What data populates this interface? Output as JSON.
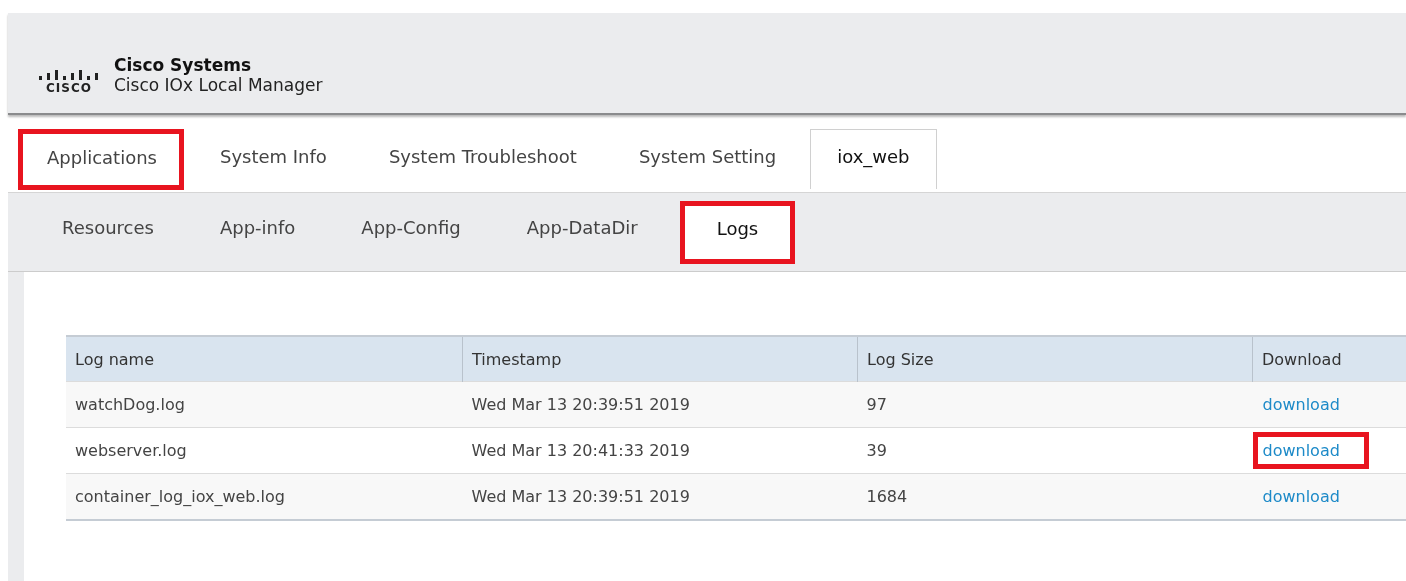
{
  "header": {
    "logo_text": "CISCO",
    "company": "Cisco Systems",
    "product": "Cisco IOx Local Manager"
  },
  "tabs": [
    {
      "label": "Applications",
      "selected": false,
      "highlighted": true
    },
    {
      "label": "System Info",
      "selected": false,
      "highlighted": false
    },
    {
      "label": "System Troubleshoot",
      "selected": false,
      "highlighted": false
    },
    {
      "label": "System Setting",
      "selected": false,
      "highlighted": false
    },
    {
      "label": "iox_web",
      "selected": true,
      "highlighted": false
    }
  ],
  "subtabs": [
    {
      "label": "Resources",
      "selected": false,
      "highlighted": false
    },
    {
      "label": "App-info",
      "selected": false,
      "highlighted": false
    },
    {
      "label": "App-Config",
      "selected": false,
      "highlighted": false
    },
    {
      "label": "App-DataDir",
      "selected": false,
      "highlighted": false
    },
    {
      "label": "Logs",
      "selected": true,
      "highlighted": true
    }
  ],
  "table": {
    "columns": [
      "Log name",
      "Timestamp",
      "Log Size",
      "Download"
    ],
    "rows": [
      {
        "name": "watchDog.log",
        "timestamp": "Wed Mar 13 20:39:51 2019",
        "size": "97",
        "link": "download",
        "highlighted": false
      },
      {
        "name": "webserver.log",
        "timestamp": "Wed Mar 13 20:41:33 2019",
        "size": "39",
        "link": "download",
        "highlighted": true
      },
      {
        "name": "container_log_iox_web.log",
        "timestamp": "Wed Mar 13 20:39:51 2019",
        "size": "1684",
        "link": "download",
        "highlighted": false
      }
    ]
  }
}
